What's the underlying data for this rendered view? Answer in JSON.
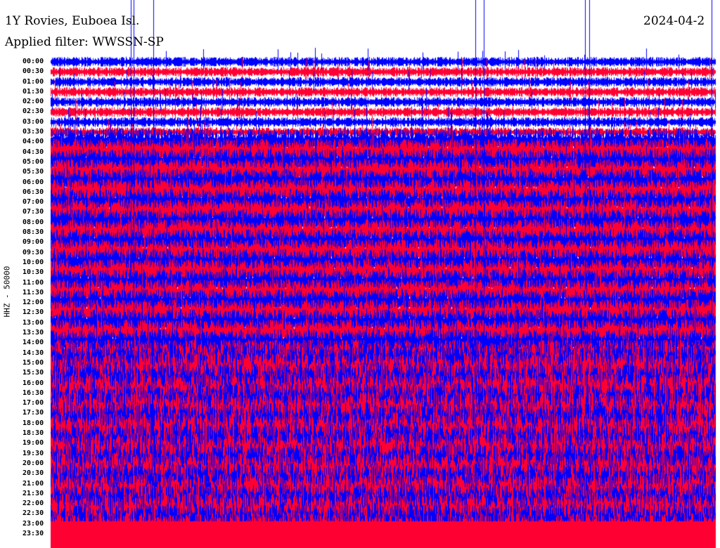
{
  "header": {
    "station": "1Y Rovies, Euboea Isl.",
    "filter": "Applied filter: WWSSN-SP",
    "date": "2024-04-2"
  },
  "colors": {
    "trace_a": "#0000ff",
    "trace_b": "#ff0033"
  },
  "chart_data": {
    "type": "line",
    "title": "1Y Rovies, Euboea Isl.",
    "ylabel": "HHZ - 50000",
    "xlabel": "",
    "row_labels": [
      "00:00",
      "00:30",
      "01:00",
      "01:30",
      "02:00",
      "02:30",
      "03:00",
      "03:30",
      "04:00",
      "04:30",
      "05:00",
      "05:30",
      "06:00",
      "06:30",
      "07:00",
      "07:30",
      "08:00",
      "08:30",
      "09:00",
      "09:30",
      "10:00",
      "10:30",
      "11:00",
      "11:30",
      "12:00",
      "12:30",
      "13:00",
      "13:30",
      "14:00",
      "14:30",
      "15:00",
      "15:30",
      "16:00",
      "16:30",
      "17:00",
      "17:30",
      "18:00",
      "18:30",
      "19:00",
      "19:30",
      "20:00",
      "20:30",
      "21:00",
      "21:30",
      "22:00",
      "22:30",
      "23:00",
      "23:30"
    ],
    "series": [
      {
        "name": "HHZ",
        "colors_alternate": [
          "#0000ff",
          "#ff0033"
        ]
      }
    ]
  }
}
